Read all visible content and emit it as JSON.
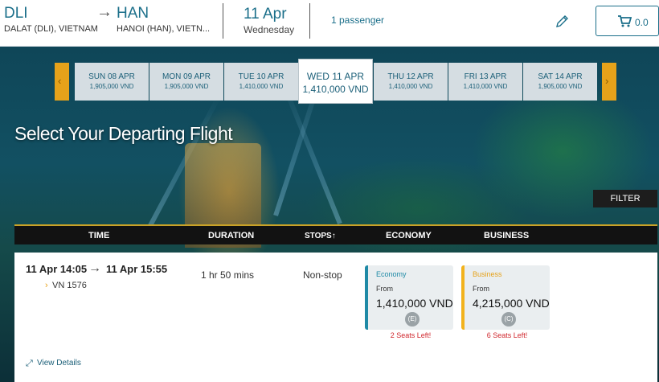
{
  "header": {
    "from_code": "DLI",
    "from_name": "DALAT (DLI), VIETNAM",
    "to_code": "HAN",
    "to_name": "HANOI (HAN), VIETN...",
    "date": "11 Apr",
    "weekday": "Wednesday",
    "passengers": "1 passenger",
    "cart_total": "0.0",
    "arrow_glyph": "→"
  },
  "date_strip": {
    "prev_glyph": "‹",
    "next_glyph": "›",
    "dates": [
      {
        "label": "SUN 08 APR",
        "price": "1,905,000 VND"
      },
      {
        "label": "MON 09 APR",
        "price": "1,905,000 VND"
      },
      {
        "label": "TUE 10 APR",
        "price": "1,410,000 VND"
      },
      {
        "label": "WED 11 APR",
        "price": "1,410,000 VND"
      },
      {
        "label": "THU 12 APR",
        "price": "1,410,000 VND"
      },
      {
        "label": "FRI 13 APR",
        "price": "1,410,000 VND"
      },
      {
        "label": "SAT 14 APR",
        "price": "1,905,000 VND"
      }
    ],
    "selected_index": 3
  },
  "page_title": "Select Your Departing Flight",
  "filter_label": "FILTER",
  "columns": {
    "time": "TIME",
    "duration": "DURATION",
    "stops": "STOPS↑",
    "economy": "ECONOMY",
    "business": "BUSINESS"
  },
  "flight": {
    "depart": "11 Apr 14:05",
    "arrow": "→",
    "arrive": "11 Apr 15:55",
    "flight_chevron": "›",
    "flight_no": "VN 1576",
    "duration": "1 hr 50 mins",
    "stops": "Non-stop",
    "economy": {
      "title": "Economy",
      "from": "From",
      "price": "1,410,000 VND",
      "class_code": "(E)",
      "seats": "2 Seats Left!"
    },
    "business": {
      "title": "Business",
      "from": "From",
      "price": "4,215,000 VND",
      "class_code": "(C)",
      "seats": "6 Seats Left!"
    },
    "view_details": "View Details",
    "expand_glyph": "⤢"
  },
  "icons": {
    "edit": "pencil-icon",
    "cart": "cart-icon"
  },
  "colors": {
    "brand_blue": "#1b6f8a",
    "accent_gold": "#e6a21a",
    "economy_bar": "#1f8aa6",
    "business_bar": "#f2b21c",
    "warning_red": "#d0282e"
  }
}
